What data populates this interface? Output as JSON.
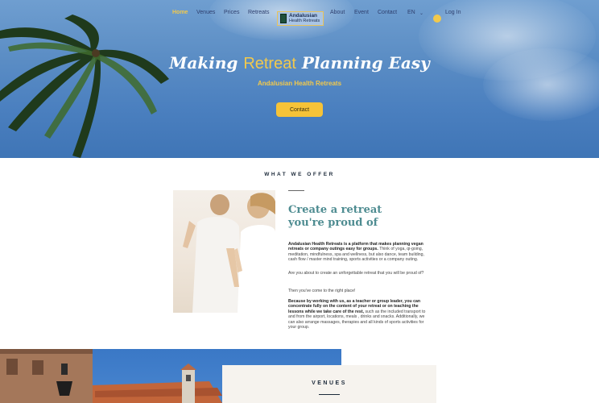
{
  "nav": {
    "items": [
      "Home",
      "Venues",
      "Prices",
      "Retreats",
      "About",
      "Event",
      "Contact"
    ],
    "logo_line1": "Andalusian",
    "logo_line2": "Health Retreats",
    "language": "EN",
    "login": "Log In"
  },
  "hero": {
    "title_part1": "Making ",
    "title_part2": "Retreat",
    "title_part3": " Planning Easy",
    "subtitle": "Andalusian Health Retreats",
    "cta": "Contact"
  },
  "offer": {
    "section_title": "WHAT WE OFFER",
    "heading_line1": "Create a retreat",
    "heading_line2": "you're proud of",
    "p1_bold": "Andalusian Health Retreats is a platform that makes planning vegan retreats or company outings easy for groups.",
    "p1_rest": " Think of yoga, qi-going, meditation, mindfulness, spa and wellness, but also dance, team building, cash flow / master mind training, sports activities or a company outing.",
    "p2": "Are you about to create an unforgettable retreat that you will be proud of?",
    "p3": "Then you've come to the right place!",
    "p4_bold": "Because by working with us, as a teacher or group leader, you can concentrate fully on the content of your retreat or on teaching the lessons while we take care of the rest,",
    "p4_rest": " such as the included transport to and from the airport, locations, meals , drinks and snacks. Additionally, we can also arrange massages, therapies and all kinds of sports activities for your group."
  },
  "venues": {
    "title": "VENUES"
  },
  "colors": {
    "accent_yellow": "#f2c94c",
    "heading_teal": "#4e8c91",
    "nav_text": "#2e3f6e"
  }
}
